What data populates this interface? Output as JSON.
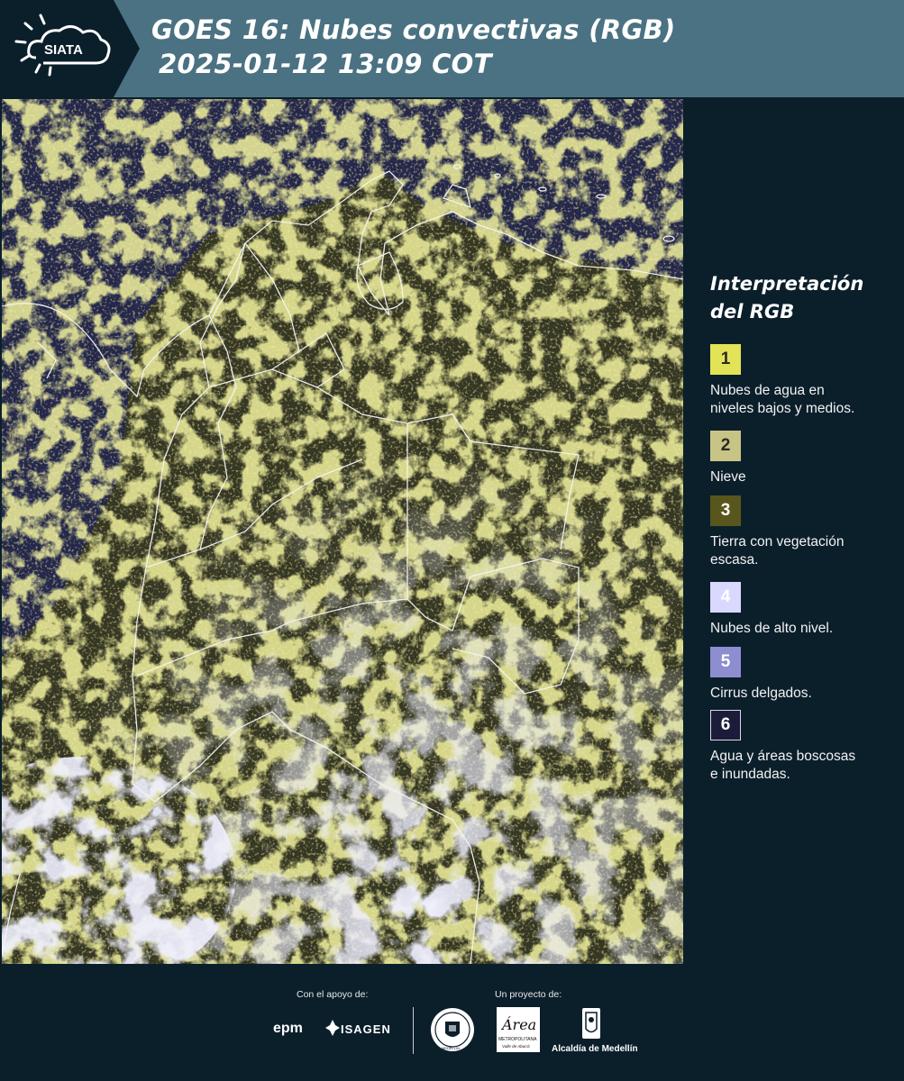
{
  "header": {
    "title_line1": "GOES 16: Nubes convectivas (RGB)",
    "title_line2": "2025-01-12 13:09 COT",
    "logo_text": "SIATA"
  },
  "map": {
    "description_icon": "satellite-rgb-map"
  },
  "legend": {
    "title_line1": "Interpretación",
    "title_line2": "del RGB",
    "items": [
      {
        "number": "1",
        "color": "#e3e357",
        "text_color": "#2a2a2a",
        "label_line1": "Nubes de agua en",
        "label_line2": "niveles bajos y medios."
      },
      {
        "number": "2",
        "color": "#c8c485",
        "text_color": "#2a2a2a",
        "label_line1": "Nieve",
        "label_line2": ""
      },
      {
        "number": "3",
        "color": "#58561c",
        "text_color": "#ffffff",
        "label_line1": "Tierra con vegetación",
        "label_line2": "escasa."
      },
      {
        "number": "4",
        "color": "#d9d9ff",
        "text_color": "#ffffff",
        "label_line1": "Nubes de alto nivel.",
        "label_line2": ""
      },
      {
        "number": "5",
        "color": "#8c8ed0",
        "text_color": "#ffffff",
        "label_line1": "Cirrus delgados.",
        "label_line2": ""
      },
      {
        "number": "6",
        "color": "#1c1c3a",
        "text_color": "#ffffff",
        "label_line1": "Agua y áreas boscosas",
        "label_line2": "e inundadas."
      }
    ]
  },
  "footer": {
    "support_caption": "Con el apoyo de:",
    "project_caption": "Un proyecto de:",
    "sponsor1": "epm",
    "sponsor2": "ISAGEN",
    "partner1": "MEDELLÍN",
    "partner2_title": "Área",
    "partner2_sub": "METROPOLITANA",
    "partner2_sub2": "Valle de Aburrá",
    "partner3": "Alcaldía de Medellín"
  }
}
